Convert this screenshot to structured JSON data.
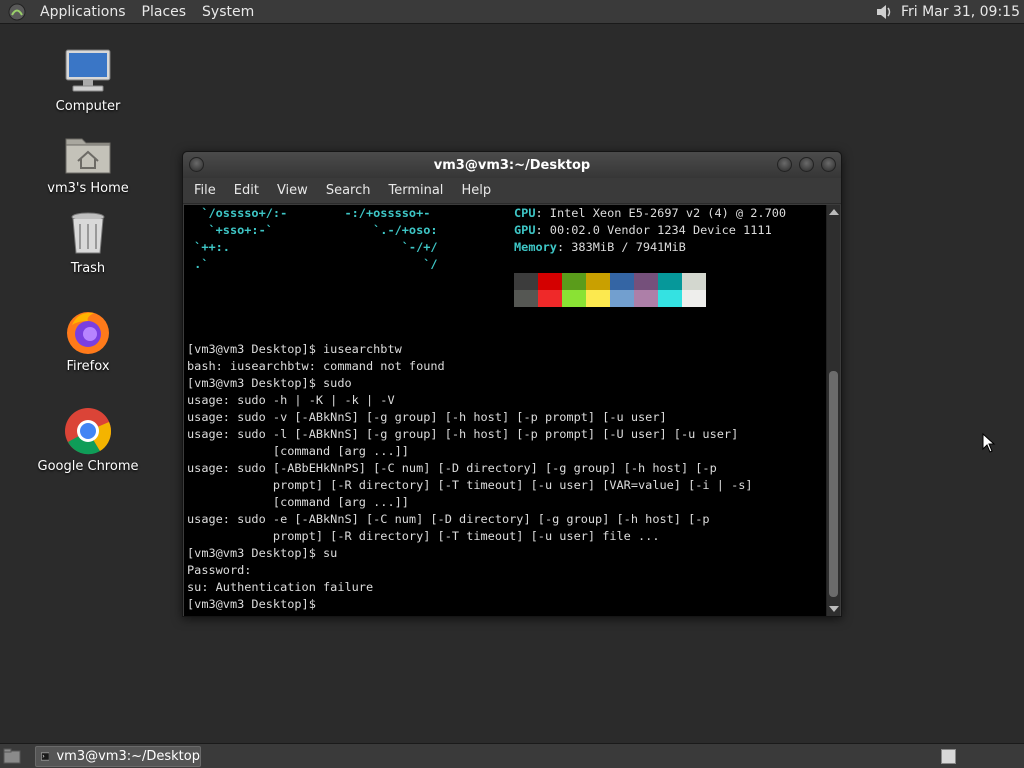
{
  "top_panel": {
    "menus": [
      "Applications",
      "Places",
      "System"
    ],
    "clock": "Fri Mar 31, 09:15"
  },
  "desktop_icons": [
    {
      "label": "Computer",
      "icon": "computer-icon"
    },
    {
      "label": "vm3's Home",
      "icon": "home-folder-icon"
    },
    {
      "label": "Trash",
      "icon": "trash-icon"
    },
    {
      "label": "Firefox",
      "icon": "firefox-icon"
    },
    {
      "label": "Google Chrome",
      "icon": "chrome-icon"
    }
  ],
  "terminal": {
    "title": "vm3@vm3:~/Desktop",
    "menu": [
      "File",
      "Edit",
      "View",
      "Search",
      "Terminal",
      "Help"
    ],
    "ascii_art": [
      "  `/osssso+/:-        -:/+osssso+-",
      "   `+sso+:-`              `.-/+oso:",
      " `++:.                        `-/+/",
      " .`                              `/"
    ],
    "sysinfo": [
      {
        "key": "CPU",
        "value": ": Intel Xeon E5-2697 v2 (4) @ 2.700"
      },
      {
        "key": "GPU",
        "value": ": 00:02.0 Vendor 1234 Device 1111"
      },
      {
        "key": "Memory",
        "value": ": 383MiB / 7941MiB"
      }
    ],
    "palette_dark": [
      "#3c3c3c",
      "#d40000",
      "#5a9c1b",
      "#c9a000",
      "#3465a4",
      "#75507b",
      "#06989a",
      "#d3d7cf"
    ],
    "palette_light": [
      "#555753",
      "#ef2929",
      "#8ae234",
      "#fce94f",
      "#729fcf",
      "#ad7fa8",
      "#34e2e2",
      "#eeeeec"
    ],
    "output": [
      "[vm3@vm3 Desktop]$ iusearchbtw",
      "bash: iusearchbtw: command not found",
      "[vm3@vm3 Desktop]$ sudo",
      "usage: sudo -h | -K | -k | -V",
      "usage: sudo -v [-ABkNnS] [-g group] [-h host] [-p prompt] [-u user]",
      "usage: sudo -l [-ABkNnS] [-g group] [-h host] [-p prompt] [-U user] [-u user]",
      "            [command [arg ...]]",
      "usage: sudo [-ABbEHkNnPS] [-C num] [-D directory] [-g group] [-h host] [-p",
      "            prompt] [-R directory] [-T timeout] [-u user] [VAR=value] [-i | -s]",
      "            [command [arg ...]]",
      "usage: sudo -e [-ABkNnS] [-C num] [-D directory] [-g group] [-h host] [-p",
      "            prompt] [-R directory] [-T timeout] [-u user] file ...",
      "[vm3@vm3 Desktop]$ su",
      "Password:",
      "su: Authentication failure",
      "[vm3@vm3 Desktop]$"
    ]
  },
  "taskbar": {
    "task_label": "vm3@vm3:~/Desktop"
  }
}
